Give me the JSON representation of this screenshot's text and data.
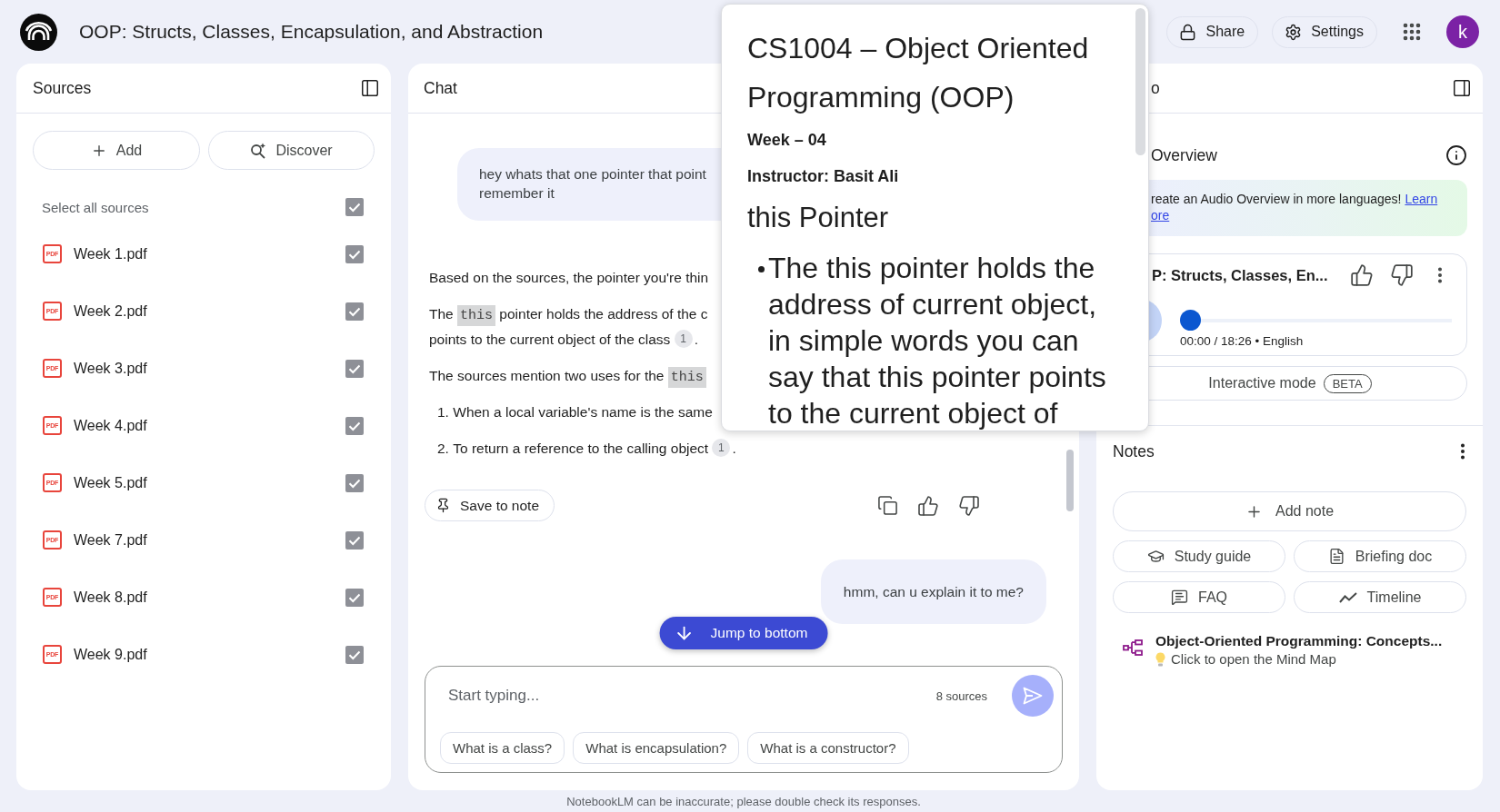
{
  "app": {
    "title": "OOP: Structs, Classes, Encapsulation, and Abstraction",
    "share_label": "Share",
    "settings_label": "Settings",
    "avatar_letter": "k"
  },
  "sources": {
    "title": "Sources",
    "add_label": "Add",
    "discover_label": "Discover",
    "select_all": {
      "label": "Select all sources",
      "checked": true
    },
    "items": [
      {
        "type": "PDF",
        "name": "Week 1.pdf",
        "checked": true
      },
      {
        "type": "PDF",
        "name": "Week 2.pdf",
        "checked": true
      },
      {
        "type": "PDF",
        "name": "Week 3.pdf",
        "checked": true
      },
      {
        "type": "PDF",
        "name": "Week 4.pdf",
        "checked": true
      },
      {
        "type": "PDF",
        "name": "Week 5.pdf",
        "checked": true
      },
      {
        "type": "PDF",
        "name": "Week 7.pdf",
        "checked": true
      },
      {
        "type": "PDF",
        "name": "Week 8.pdf",
        "checked": true
      },
      {
        "type": "PDF",
        "name": "Week 9.pdf",
        "checked": true
      }
    ]
  },
  "chat": {
    "title": "Chat",
    "messages": [
      {
        "kind": "user",
        "lines": [
          "hey whats that one pointer that point",
          "remember it"
        ]
      },
      {
        "kind": "answer",
        "save_label": "Save to note",
        "blocks": [
          {
            "kind": "paragraph",
            "lines": [
              [
                {
                  "kind": "text",
                  "text": "Based on the sources, the pointer you're thin"
                }
              ]
            ]
          },
          {
            "kind": "paragraph",
            "lines": [
              [
                {
                  "kind": "text",
                  "text": "The "
                },
                {
                  "kind": "code",
                  "text": "this"
                },
                {
                  "kind": "text",
                  "text": " pointer holds the address of the c"
                }
              ],
              [
                {
                  "kind": "text",
                  "text": "points to the current object of the class "
                },
                {
                  "kind": "cite",
                  "text": "1"
                },
                {
                  "kind": "text",
                  "text": "."
                }
              ]
            ]
          },
          {
            "kind": "paragraph",
            "lines": [
              [
                {
                  "kind": "text",
                  "text": "The sources mention two uses for the "
                },
                {
                  "kind": "code",
                  "text": "this"
                }
              ]
            ]
          },
          {
            "kind": "list_item",
            "number": "1.",
            "lines": [
              [
                {
                  "kind": "text",
                  "text": "When a local variable's name is the same"
                }
              ]
            ]
          },
          {
            "kind": "list_item",
            "number": "2.",
            "lines": [
              [
                {
                  "kind": "text",
                  "text": "To return a reference to the calling object "
                },
                {
                  "kind": "cite",
                  "text": "1"
                },
                {
                  "kind": "text",
                  "text": "."
                }
              ]
            ]
          }
        ]
      },
      {
        "kind": "user",
        "lines": [
          "hmm, can u explain it to me?"
        ]
      }
    ],
    "jump_label": "Jump to bottom",
    "input": {
      "placeholder": "Start typing...",
      "source_count": "8 sources"
    },
    "suggestions": [
      "What is a class?",
      "What is encapsulation?",
      "What is a constructor?"
    ],
    "disclaimer": "NotebookLM can be inaccurate; please double check its responses."
  },
  "source_preview": {
    "title": "CS1004 – Object Oriented Programming (OOP)",
    "week": "Week – 04",
    "instructor": "Instructor: Basit Ali",
    "heading": "this Pointer",
    "bullets": [
      "The this pointer holds the address of current object, in simple words you can say that this pointer points to the current object of"
    ]
  },
  "studio": {
    "title": "o",
    "audio_overview": {
      "title": "Overview",
      "banner": {
        "text": "reate an Audio Overview in more languages!",
        "link_lines": [
          "Learn",
          "ore"
        ]
      },
      "player": {
        "title": "P: Structs, Classes, En...",
        "time_info": "00:00 / 18:26 • English",
        "level": 0
      },
      "interactive": {
        "label": "Interactive mode",
        "badge": "BETA"
      }
    },
    "notes": {
      "title": "Notes",
      "add_label": "Add note",
      "actions": [
        {
          "kind": "study_guide",
          "label": "Study guide"
        },
        {
          "kind": "briefing_doc",
          "label": "Briefing doc"
        },
        {
          "kind": "faq",
          "label": "FAQ"
        },
        {
          "kind": "timeline",
          "label": "Timeline"
        }
      ],
      "mind_map": {
        "title": "Object-Oriented Programming: Concepts...",
        "hint": "Click to open the Mind Map"
      }
    }
  }
}
